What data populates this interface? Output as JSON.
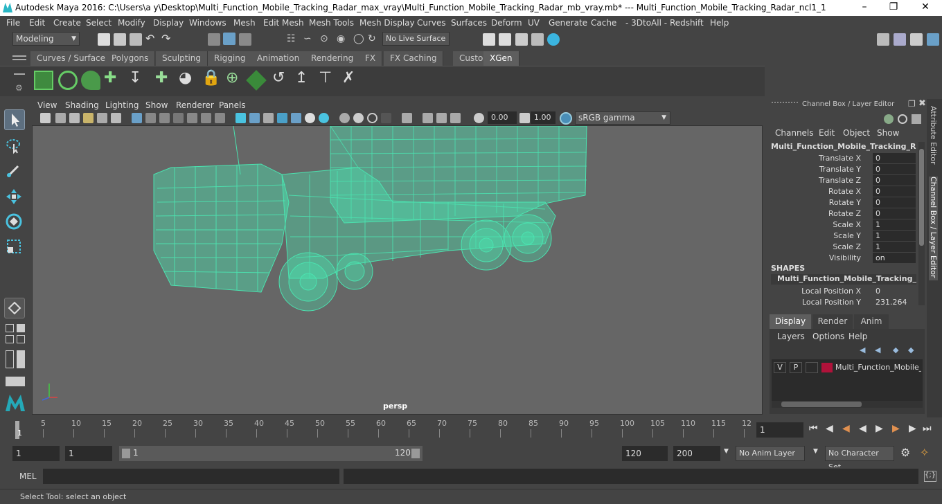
{
  "app": {
    "title": "Autodesk Maya 2016: C:\\Users\\a y\\Desktop\\Multi_Function_Mobile_Tracking_Radar_max_vray\\Multi_Function_Mobile_Tracking_Radar_mb_vray.mb*   ---   Multi_Function_Mobile_Tracking_Radar_ncl1_1",
    "accent": "#5bcfc9"
  },
  "menus": [
    "File",
    "Edit",
    "Create",
    "Select",
    "Modify",
    "Display",
    "Windows",
    "Mesh",
    "Edit Mesh",
    "Mesh Tools",
    "Mesh Display",
    "Curves",
    "Surfaces",
    "Deform",
    "UV",
    "Generate",
    "Cache",
    "- 3DtoAll -",
    "Redshift",
    "Help"
  ],
  "statusline": {
    "mode": "Modeling",
    "live_surface": "No Live Surface"
  },
  "shelf_tabs": [
    "Curves / Surfaces",
    "Polygons",
    "Sculpting",
    "Rigging",
    "Animation",
    "Rendering",
    "FX",
    "FX Caching",
    "Custom",
    "XGen"
  ],
  "active_shelf": "XGen",
  "viewport": {
    "menus": [
      "View",
      "Shading",
      "Lighting",
      "Show",
      "Renderer",
      "Panels"
    ],
    "exposure": "0.00",
    "gamma": "1.00",
    "colorspace": "sRGB gamma",
    "camera": "persp",
    "wire_color": "#4be3b0"
  },
  "channel_box": {
    "title": "Channel Box / Layer Editor",
    "menus": [
      "Channels",
      "Edit",
      "Object",
      "Show"
    ],
    "object": "Multi_Function_Mobile_Tracking_Rad...",
    "channels": [
      {
        "label": "Translate X",
        "value": "0"
      },
      {
        "label": "Translate Y",
        "value": "0"
      },
      {
        "label": "Translate Z",
        "value": "0"
      },
      {
        "label": "Rotate X",
        "value": "0"
      },
      {
        "label": "Rotate Y",
        "value": "0"
      },
      {
        "label": "Rotate Z",
        "value": "0"
      },
      {
        "label": "Scale X",
        "value": "1"
      },
      {
        "label": "Scale Y",
        "value": "1"
      },
      {
        "label": "Scale Z",
        "value": "1"
      },
      {
        "label": "Visibility",
        "value": "on"
      }
    ],
    "shapes_header": "SHAPES",
    "shape_name": "Multi_Function_Mobile_Tracking_Ra...",
    "shape_channels": [
      {
        "label": "Local Position X",
        "value": "0"
      },
      {
        "label": "Local Position Y",
        "value": "231.264"
      }
    ]
  },
  "layer_editor": {
    "tabs": [
      "Display",
      "Render",
      "Anim"
    ],
    "active_tab": "Display",
    "menus": [
      "Layers",
      "Options",
      "Help"
    ],
    "layer": {
      "v": "V",
      "p": "P",
      "name": "Multi_Function_Mobile_T",
      "color": "#b0123a"
    }
  },
  "side_tabs": [
    "Attribute Editor",
    "Channel Box / Layer Editor"
  ],
  "timeline": {
    "ticks": [
      "5",
      "10",
      "15",
      "20",
      "25",
      "30",
      "35",
      "40",
      "45",
      "50",
      "55",
      "60",
      "65",
      "70",
      "75",
      "80",
      "85",
      "90",
      "95",
      "100",
      "105",
      "110",
      "115",
      "12"
    ],
    "start_marker": "1",
    "current_frame": "1"
  },
  "range": {
    "start": "1",
    "playback_start": "1",
    "slider_start": "1",
    "slider_end": "120",
    "playback_end": "120",
    "end": "200",
    "anim_layer": "No Anim Layer",
    "character_set": "No Character Set"
  },
  "mel": {
    "label": "MEL"
  },
  "help_line": "Select Tool: select an object"
}
